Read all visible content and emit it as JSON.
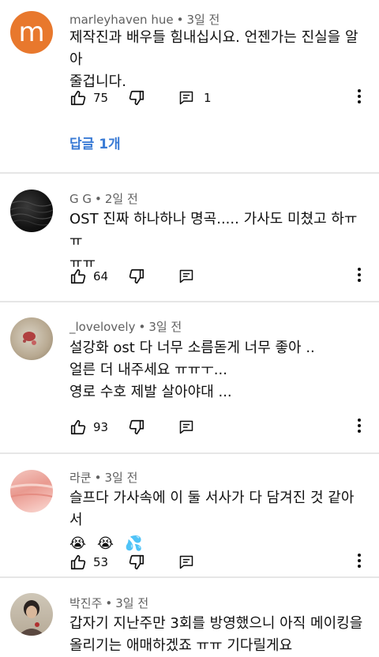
{
  "comments": [
    {
      "author": "marleyhaven hue",
      "time": "3일 전",
      "avatar_letter": "m",
      "text": "제작진과 배우들 힘내십시요. 언젠가는 진실을 알아\n줄겁니다.",
      "likes": "75",
      "reply_count": "1",
      "replies_link": "답글 1개"
    },
    {
      "author": "G G",
      "time": "2일 전",
      "text": "OST 진짜 하나하나 명곡..... 가사도 미쳤고 하ㅠㅠ\nㅠㅠ",
      "likes": "64"
    },
    {
      "author": "_lovelovely",
      "time": "3일 전",
      "text": "설강화 ost 다 너무 소름돋게 너무 좋아 ..\n얼른 더 내주세요 ㅠㅠㅜ...\n영로 수호 제발 살아야대 ...",
      "likes": "93"
    },
    {
      "author": "라쿤",
      "time": "3일 전",
      "text": "슬프다 가사속에 이 둘 서사가 다 담겨진 것 같아서",
      "emojis": [
        "😭",
        "😭",
        "💦"
      ],
      "likes": "53"
    },
    {
      "author": "박진주",
      "time": "3일 전",
      "text": "갑자기 지난주만 3회를 방영했으니 아직 메이킹을\n올리기는 애매하겠죠 ㅠㅠ 기다릴게요"
    }
  ],
  "icons": {
    "like": "thumbs-up-icon",
    "dislike": "thumbs-down-icon",
    "reply": "reply-comment-icon",
    "more": "more-vertical-icon"
  },
  "colors": {
    "avatar_m": "#e8782d",
    "link": "#3a7bd5",
    "meta": "#606060"
  }
}
